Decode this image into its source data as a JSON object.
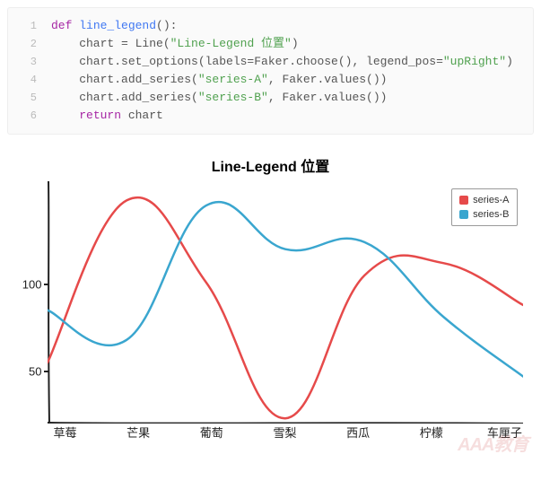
{
  "code": {
    "lines": [
      {
        "no": "1",
        "text": "def line_legend():"
      },
      {
        "no": "2",
        "text": "    chart = Line(\"Line-Legend 位置\")"
      },
      {
        "no": "3",
        "text": "    chart.set_options(labels=Faker.choose(), legend_pos=\"upRight\")"
      },
      {
        "no": "4",
        "text": "    chart.add_series(\"series-A\", Faker.values())"
      },
      {
        "no": "5",
        "text": "    chart.add_series(\"series-B\", Faker.values())"
      },
      {
        "no": "6",
        "text": "    return chart"
      }
    ]
  },
  "chart_data": {
    "type": "line",
    "title": "Line-Legend 位置",
    "xlabel": "",
    "ylabel": "",
    "legend_position": "upRight",
    "ylim": [
      20,
      160
    ],
    "yticks": [
      50,
      100
    ],
    "categories": [
      "草莓",
      "芒果",
      "葡萄",
      "雪梨",
      "西瓜",
      "柠檬",
      "车厘子"
    ],
    "series": [
      {
        "name": "series-A",
        "color": "#e64a4a",
        "values": [
          55,
          148,
          101,
          23,
          105,
          112,
          88
        ]
      },
      {
        "name": "series-B",
        "color": "#3aa6cf",
        "values": [
          85,
          68,
          145,
          120,
          124,
          81,
          47
        ]
      }
    ]
  },
  "legend": {
    "a": "series-A",
    "b": "series-B"
  },
  "watermark": "AAA教育"
}
